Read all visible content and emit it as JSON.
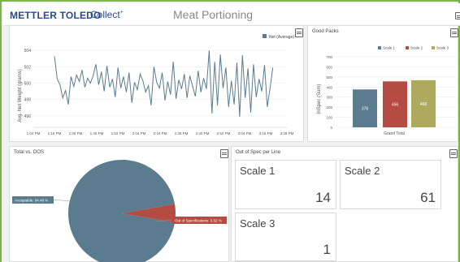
{
  "header": {
    "brand": "METTLER TOLEDO",
    "product": "Collect",
    "product_mark": "+",
    "page_title": "Meat Portioning"
  },
  "panels": {
    "net_weight": {
      "chart_data": {
        "type": "line",
        "ylabel": "Avg. Net Weight (grams)",
        "ylim": [
          495,
          505
        ],
        "yticks": [
          "504",
          "502",
          "500",
          "498",
          "496"
        ],
        "xticks": [
          "1:04 PM",
          "1:16 PM",
          "1:28 PM",
          "1:40 PM",
          "1:52 PM",
          "2:04 PM",
          "2:16 PM",
          "2:28 PM",
          "2:40 PM",
          "2:52 PM",
          "3:04 PM",
          "3:16 PM",
          "3:28 PM"
        ],
        "legend": "Net (Average)",
        "color": "#5b7b8e",
        "series": [
          {
            "name": "Net (Average)",
            "x_start": "1:16 PM",
            "x_end": "3:20 PM",
            "values": [
              503.3,
              500.5,
              499.8,
              498.2,
              499.1,
              497.4,
              500.8,
              499.6,
              501.0,
              500.2,
              501.6,
              499.5,
              500.6,
              500.0,
              500.9,
              502.3,
              499.8,
              501.4,
              499.0,
              502.1,
              499.5,
              500.5,
              498.3,
              501.9,
              499.4,
              500.8,
              498.9,
              501.3,
              497.6,
              500.1,
              499.2,
              501.1,
              500.3,
              498.9,
              499.7,
              497.3,
              502.0,
              500.1,
              499.4,
              501.3,
              497.9,
              500.2,
              498.6,
              502.6,
              498.1,
              500.4,
              499.3,
              501.1,
              498.2,
              500.9,
              499.6,
              498.4,
              501.5,
              498.9,
              500.6,
              499.3,
              504.0,
              496.3,
              502.6,
              497.3,
              503.5,
              499.4,
              501.9,
              497.1,
              500.3,
              497.4,
              502.5,
              495.9,
              503.4,
              498.2,
              501.8,
              496.4,
              502.3,
              498.3,
              500.5,
              499.0,
              502.2,
              497.1,
              499.4,
              501.9
            ]
          }
        ]
      }
    },
    "good_packs": {
      "title": "Good Packs",
      "chart_data": {
        "type": "bar",
        "ylabel": "InSpec (Sum)",
        "ylim": [
          0,
          700
        ],
        "yticks": [
          "700",
          "600",
          "500",
          "400",
          "300",
          "200",
          "100",
          "0"
        ],
        "categories": [
          "Grand Total"
        ],
        "series": [
          {
            "name": "Scale 1",
            "value": 376,
            "label": "376",
            "color": "#5b7b8e"
          },
          {
            "name": "Scale 2",
            "value": 456,
            "label": "456",
            "color": "#b44c43"
          },
          {
            "name": "Scale 3",
            "value": 468,
            "label": "468",
            "color": "#adaa5e"
          }
        ]
      }
    },
    "total_vs_oos": {
      "title": "Total vs. OOS",
      "chart_data": {
        "type": "pie",
        "slices": [
          {
            "name": "Acceptable",
            "label": "Acceptable: 94.48 %",
            "value": 94.48,
            "color": "#5b7b8e"
          },
          {
            "name": "Out of Specifications",
            "label": "Out of Specifications: 5.52 %",
            "value": 5.52,
            "color": "#b44c43"
          }
        ]
      }
    },
    "oos_per_line": {
      "title": "Out of Spec per Line",
      "cards": [
        {
          "name": "Scale 1",
          "count": "14"
        },
        {
          "name": "Scale 2",
          "count": "61"
        },
        {
          "name": "Scale 3",
          "count": "1"
        }
      ]
    }
  }
}
